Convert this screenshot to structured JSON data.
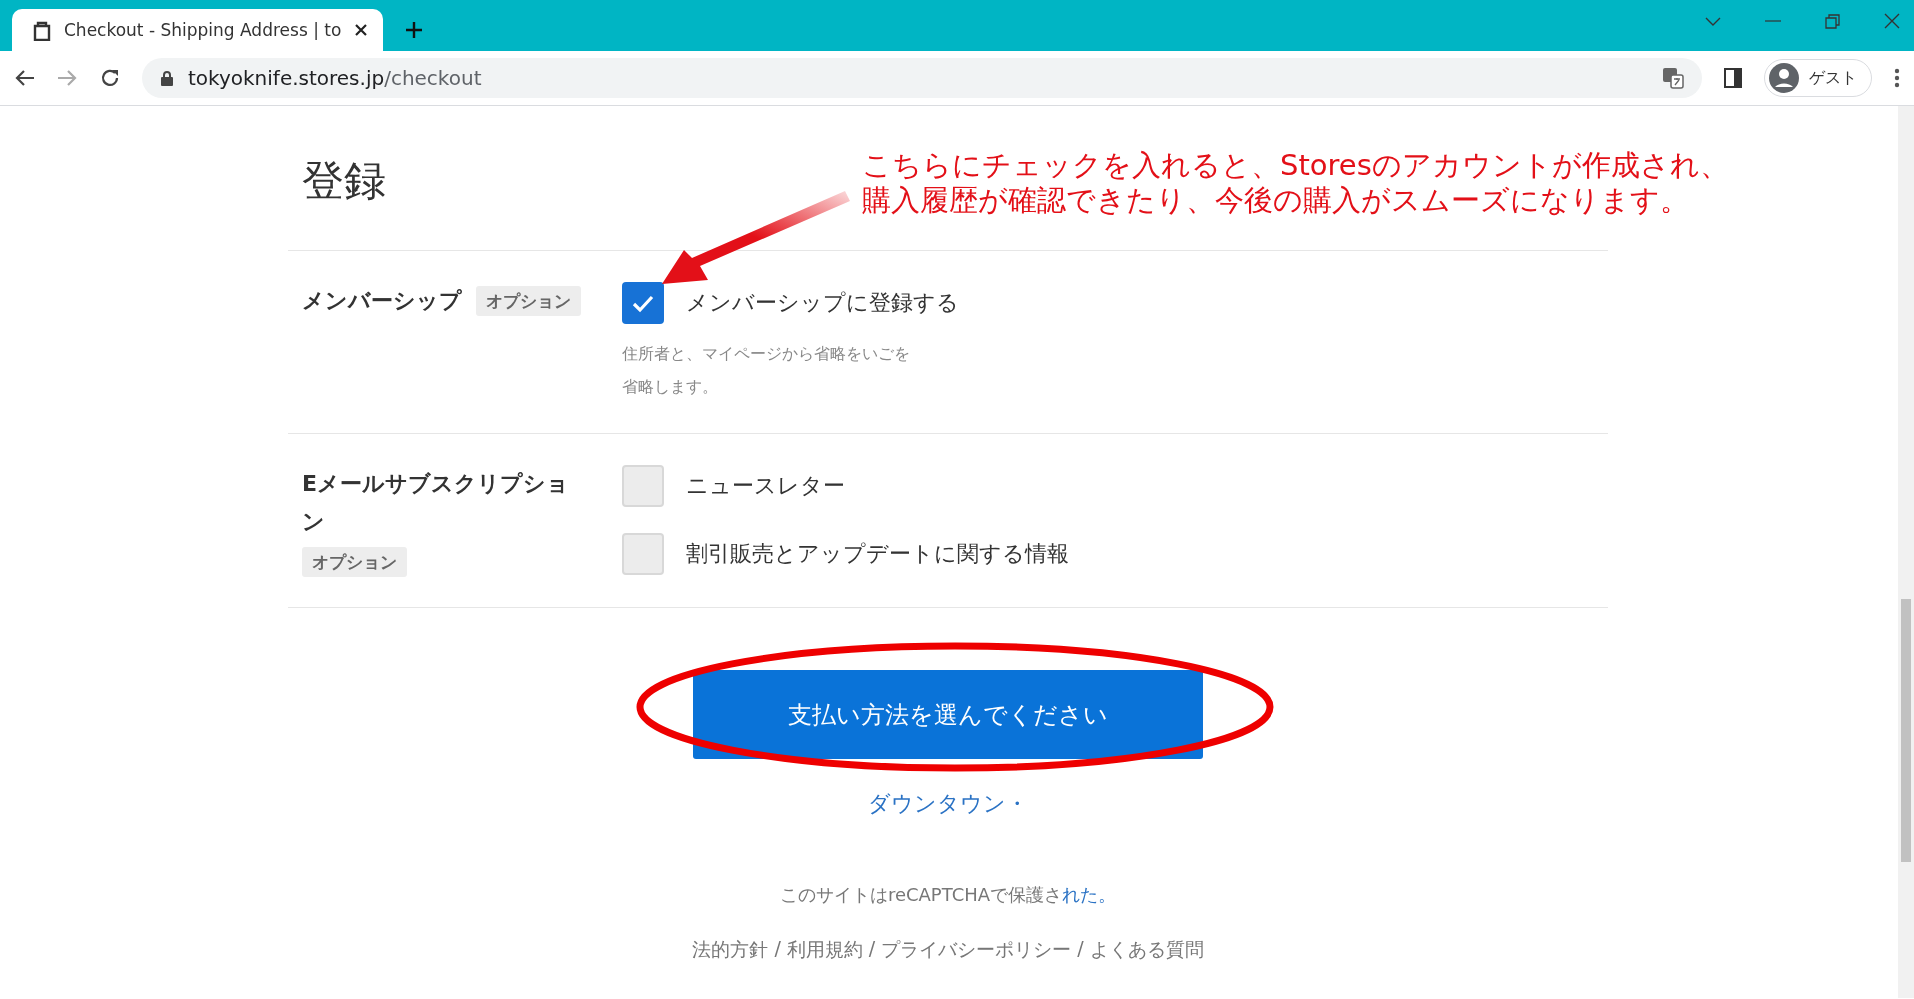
{
  "browser": {
    "tab": {
      "title": "Checkout - Shipping Address | to",
      "selected": true
    },
    "url_host": "tokyoknife.stores.jp",
    "url_path": "/checkout",
    "profile": "ゲスト"
  },
  "heading": "登録",
  "annotation": {
    "lines": [
      "こちらにチェックを入れると、Storesのアカウントが作成され、",
      "購入履歴が確認できたり、今後の購入がスムーズになります。"
    ]
  },
  "sections": [
    {
      "label": "メンバーシップ",
      "badge": "オプション",
      "options": [
        {
          "label": "メンバーシップに登録する",
          "checked": true
        }
      ],
      "description": "住所者と、マイページから省略をいごを省略します。"
    },
    {
      "label": "Eメールサブスクリプション",
      "badge": "オプション",
      "options": [
        {
          "label": "ニュースレター",
          "checked": false
        },
        {
          "label": "割引販売とアップデートに関する情報",
          "checked": false
        }
      ]
    }
  ],
  "submit_button": "支払い方法を選んでください",
  "link": "ダウンタウン・",
  "recaptcha": {
    "text": "このサイトはreCAPTCHAで保護さ",
    "link": "れた。"
  },
  "footer_links": [
    "法的方針",
    "利用規約",
    "プライバシーポリシー",
    "よくある質問"
  ],
  "footer_separators": [
    "/",
    "/",
    "/"
  ]
}
